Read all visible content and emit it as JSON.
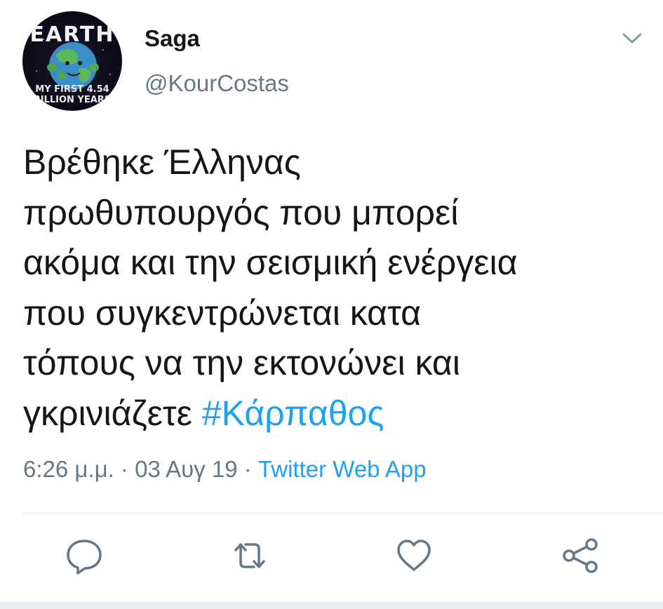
{
  "user": {
    "display_name": "Saga",
    "handle": "@KourCostas",
    "avatar_title": "EARTH",
    "avatar_caption_line1": "MY FIRST 4.54",
    "avatar_caption_line2": "BILLION YEARS"
  },
  "tweet": {
    "text_lines": [
      "Βρέθηκε Έλληνας",
      "πρωθυπουργός που μπορεί",
      "ακόμα και την σεισμική ενέργεια",
      "που συγκεντρώνεται κατα",
      "τόπους να την εκτονώνει και"
    ],
    "last_line_text": "γκρινιάζετε ",
    "hashtag": "#Κάρπαθος"
  },
  "meta": {
    "time": "6:26 μ.μ.",
    "separator1": " · ",
    "date": "03 Αυγ 19",
    "separator2": " · ",
    "source": "Twitter Web App"
  },
  "icons": {
    "caret": "chevron-down-icon",
    "reply": "reply-icon",
    "retweet": "retweet-icon",
    "like": "heart-icon",
    "share": "share-icon"
  },
  "colors": {
    "text": "#14171a",
    "secondary": "#657786",
    "accent": "#1da1f2",
    "divider": "#e1e8ed"
  }
}
